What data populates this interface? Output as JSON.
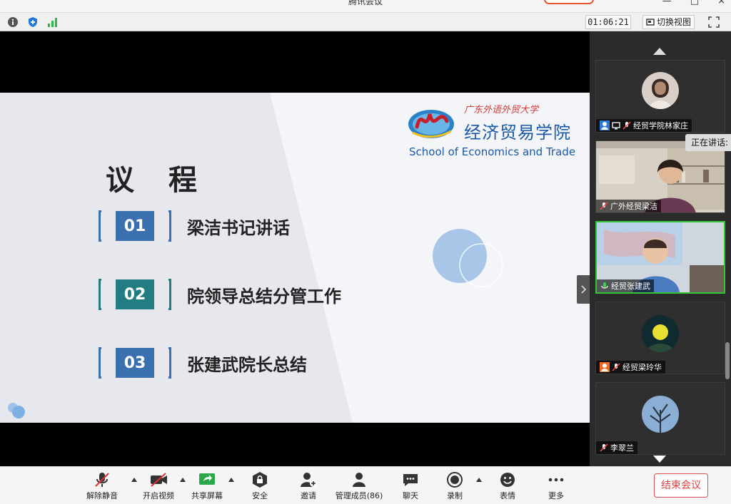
{
  "window": {
    "title": "腾讯会议"
  },
  "infobar": {
    "timer": "01:06:21",
    "switch_view_label": "切换视图"
  },
  "slide": {
    "logo": {
      "university_cn": "广东外语外贸大学",
      "college_cn": "经济贸易学院",
      "college_en": "School of Economics and Trade"
    },
    "title": "议程",
    "items": [
      {
        "num": "01",
        "text": "梁洁书记讲话"
      },
      {
        "num": "02",
        "text": "院领导总结分管工作"
      },
      {
        "num": "03",
        "text": "张建武院长总结"
      }
    ]
  },
  "gallery": {
    "speaking_label": "正在讲话:",
    "participants": [
      {
        "name": "经贸学院林家庄",
        "muted": true,
        "video": false
      },
      {
        "name": "广外经贸梁洁",
        "muted": true,
        "video": true
      },
      {
        "name": "经贸张建武",
        "muted": false,
        "video": true,
        "active": true
      },
      {
        "name": "经贸梁玲华",
        "muted": true,
        "video": false
      },
      {
        "name": "李翠兰",
        "muted": true,
        "video": false
      }
    ]
  },
  "toolbar": {
    "unmute": "解除静音",
    "start_video": "开启视频",
    "share_screen": "共享屏幕",
    "security": "安全",
    "invite": "邀请",
    "manage_members": "管理成员(86)",
    "chat": "聊天",
    "record": "录制",
    "reactions": "表情",
    "more": "更多",
    "end_meeting": "结束会议"
  },
  "colors": {
    "accent_blue": "#3a6fb0",
    "accent_teal": "#227d82",
    "end_red": "#e04040",
    "active_green": "#32c732"
  }
}
